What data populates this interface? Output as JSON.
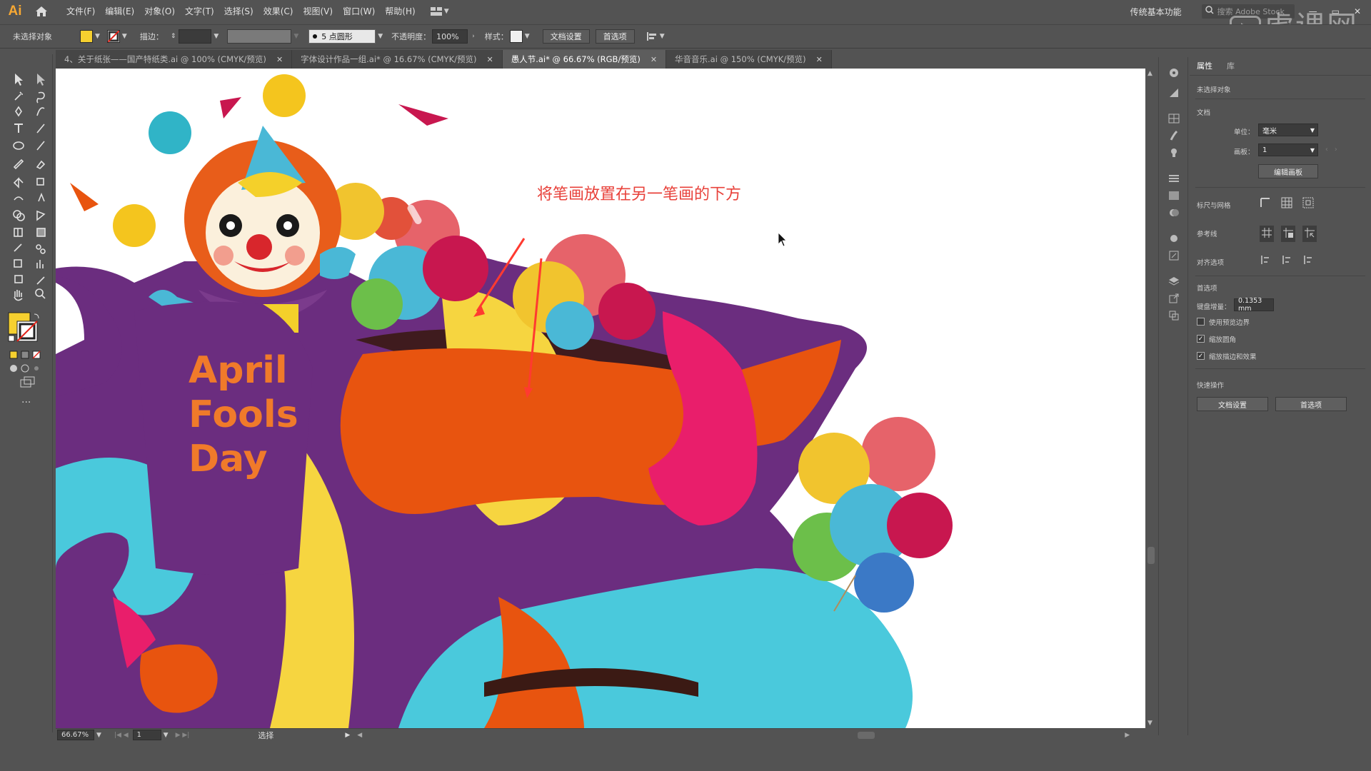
{
  "app": {
    "logo": "Ai",
    "menus": [
      "文件(F)",
      "编辑(E)",
      "对象(O)",
      "文字(T)",
      "选择(S)",
      "效果(C)",
      "视图(V)",
      "窗口(W)",
      "帮助(H)"
    ],
    "workspace": "传统基本功能",
    "search_placeholder": "搜索 Adobe Stock",
    "watermark": "虎课网"
  },
  "control_bar": {
    "selection_status": "未选择对象",
    "stroke_label": "描边：",
    "brush": "5 点圆形",
    "opacity_label": "不透明度：",
    "opacity_value": "100%",
    "style_label": "样式：",
    "doc_setup_button": "文档设置",
    "preferences_button": "首选项",
    "fill_color": "#f6d02f"
  },
  "tabs": [
    {
      "label": "4、关于纸张——国产特纸类.ai @ 100% (CMYK/预览)",
      "active": false
    },
    {
      "label": "字体设计作品一组.ai* @ 16.67% (CMYK/预览)",
      "active": false
    },
    {
      "label": "愚人节.ai* @ 66.67% (RGB/预览)",
      "active": true
    },
    {
      "label": "华音音乐.ai @ 150% (CMYK/预览)",
      "active": false
    }
  ],
  "canvas": {
    "annotation": "将笔画放置在另一笔画的下方",
    "poster_text": [
      "April",
      "Fools",
      "Day"
    ],
    "annotation_color": "#e8413a"
  },
  "status_bar": {
    "zoom": "66.67%",
    "artboard_num": "1",
    "tool_status": "选择"
  },
  "properties_panel": {
    "tabs": [
      "属性",
      "库"
    ],
    "no_selection": "未选择对象",
    "document_section": "文档",
    "units_label": "单位：",
    "units_value": "毫米",
    "artboard_label": "画板：",
    "artboard_value": "1",
    "edit_artboards_button": "编辑画板",
    "rulers_grids_label": "标尺与网格",
    "guides_label": "参考线",
    "snap_label": "对齐选项",
    "preferences_section": "首选项",
    "keyboard_increment_label": "键盘增量：",
    "keyboard_increment_value": "0.1353 mm",
    "use_preview_bounds": "使用预览边界",
    "scale_corners": "缩放圆角",
    "scale_strokes_effects": "缩放描边和效果",
    "quick_actions_section": "快速操作",
    "doc_setup_button": "文档设置",
    "preferences_button": "首选项"
  }
}
